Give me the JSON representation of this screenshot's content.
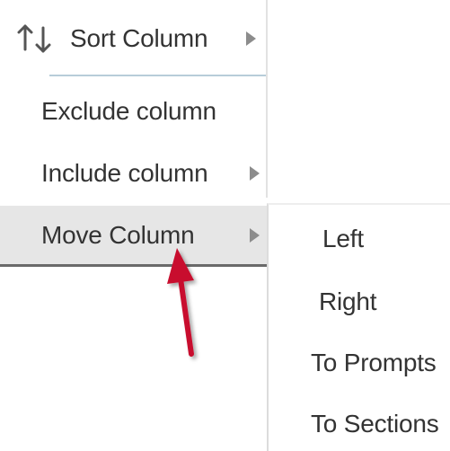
{
  "context_menu": {
    "items": [
      {
        "label": "Sort Column",
        "icon": "sort-icon",
        "has_submenu": true
      },
      {
        "label": "Exclude column",
        "has_submenu": false
      },
      {
        "label": "Include column",
        "has_submenu": true
      },
      {
        "label": "Move Column",
        "has_submenu": true,
        "highlighted": true
      }
    ]
  },
  "move_submenu": {
    "items": [
      {
        "label": "Left"
      },
      {
        "label": "Right"
      },
      {
        "label": "To Prompts"
      },
      {
        "label": "To Sections"
      }
    ]
  },
  "annotation": {
    "type": "arrow",
    "color": "#c8102e",
    "points_to": "Move Column"
  },
  "colors": {
    "highlight": "#e6e6e6",
    "text": "#333333",
    "submenu_arrow": "#8c8c8c",
    "divider": "#b7cdd9"
  }
}
